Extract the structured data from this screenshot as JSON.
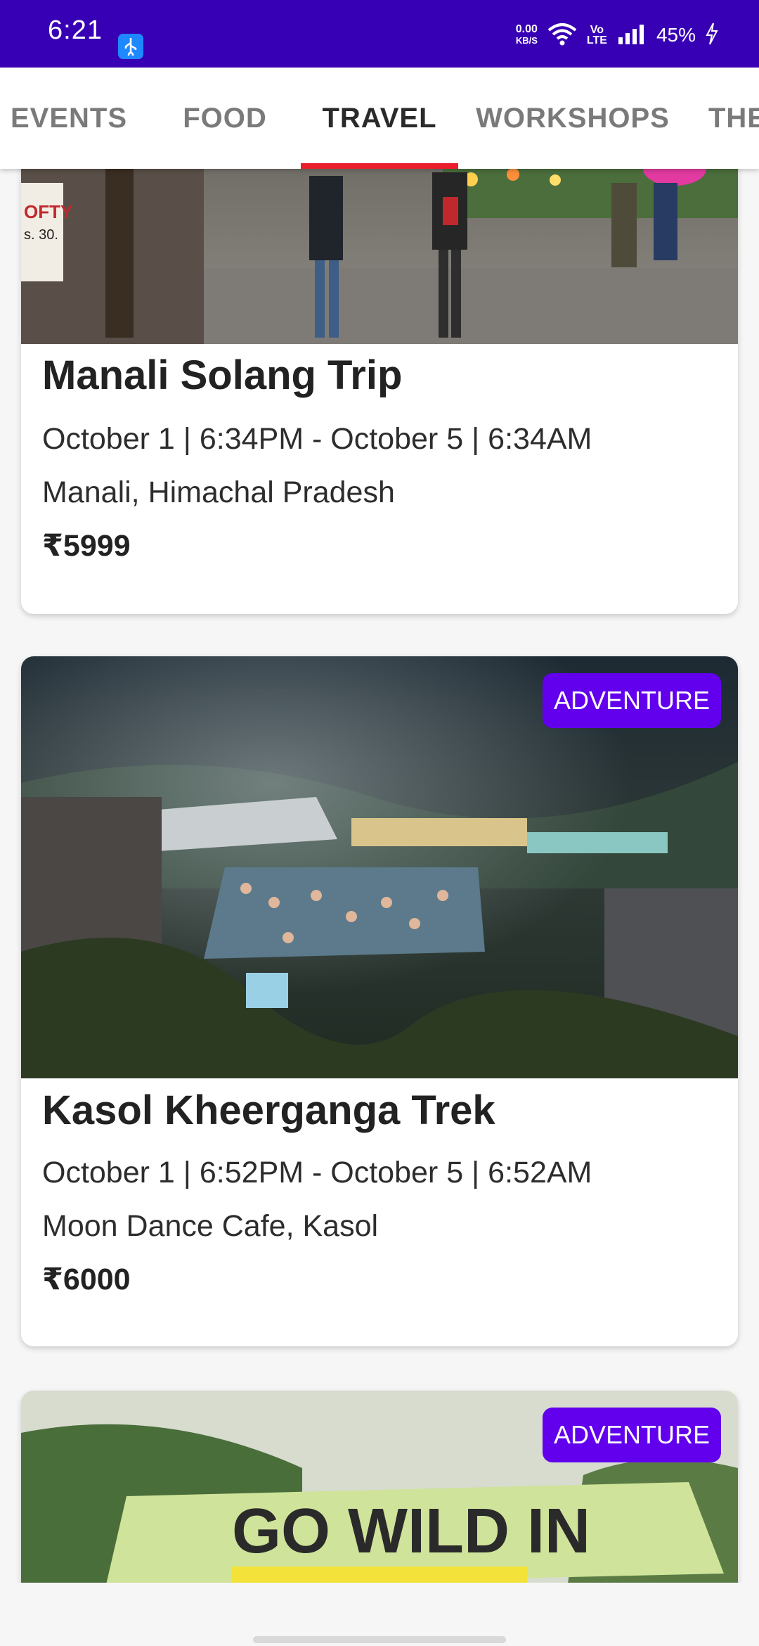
{
  "status_bar": {
    "time": "6:21",
    "net_speed_value": "0.00",
    "net_speed_unit": "KB/S",
    "volte_top": "Vo",
    "volte_bottom": "LTE",
    "battery": "45%",
    "icons": [
      "usb-icon",
      "wifi-icon",
      "signal-icon",
      "charging-icon"
    ]
  },
  "tabs": [
    {
      "label": "EVENTS",
      "active": false
    },
    {
      "label": "FOOD",
      "active": false
    },
    {
      "label": "TRAVEL",
      "active": true
    },
    {
      "label": "WORKSHOPS",
      "active": false
    },
    {
      "label": "THE",
      "active": false
    }
  ],
  "cards": [
    {
      "title": "Manali Solang Trip",
      "datetime": "October 1 | 6:34PM - October 5 | 6:34AM",
      "location": "Manali, Himachal Pradesh",
      "price": "₹5999",
      "image_sign_text": "OFTY",
      "image_price_tag": "s. 30."
    },
    {
      "badge": "ADVENTURE",
      "title": "Kasol Kheerganga Trek",
      "datetime": "October 1 | 6:52PM - October 5 | 6:52AM",
      "location": "Moon Dance Cafe, Kasol",
      "price": "₹6000"
    },
    {
      "badge": "ADVENTURE",
      "image_caption": "GO WILD IN"
    }
  ],
  "colors": {
    "status_bar": "#3800b4",
    "badge": "#6200ee",
    "tab_indicator": "#e91e2a"
  }
}
